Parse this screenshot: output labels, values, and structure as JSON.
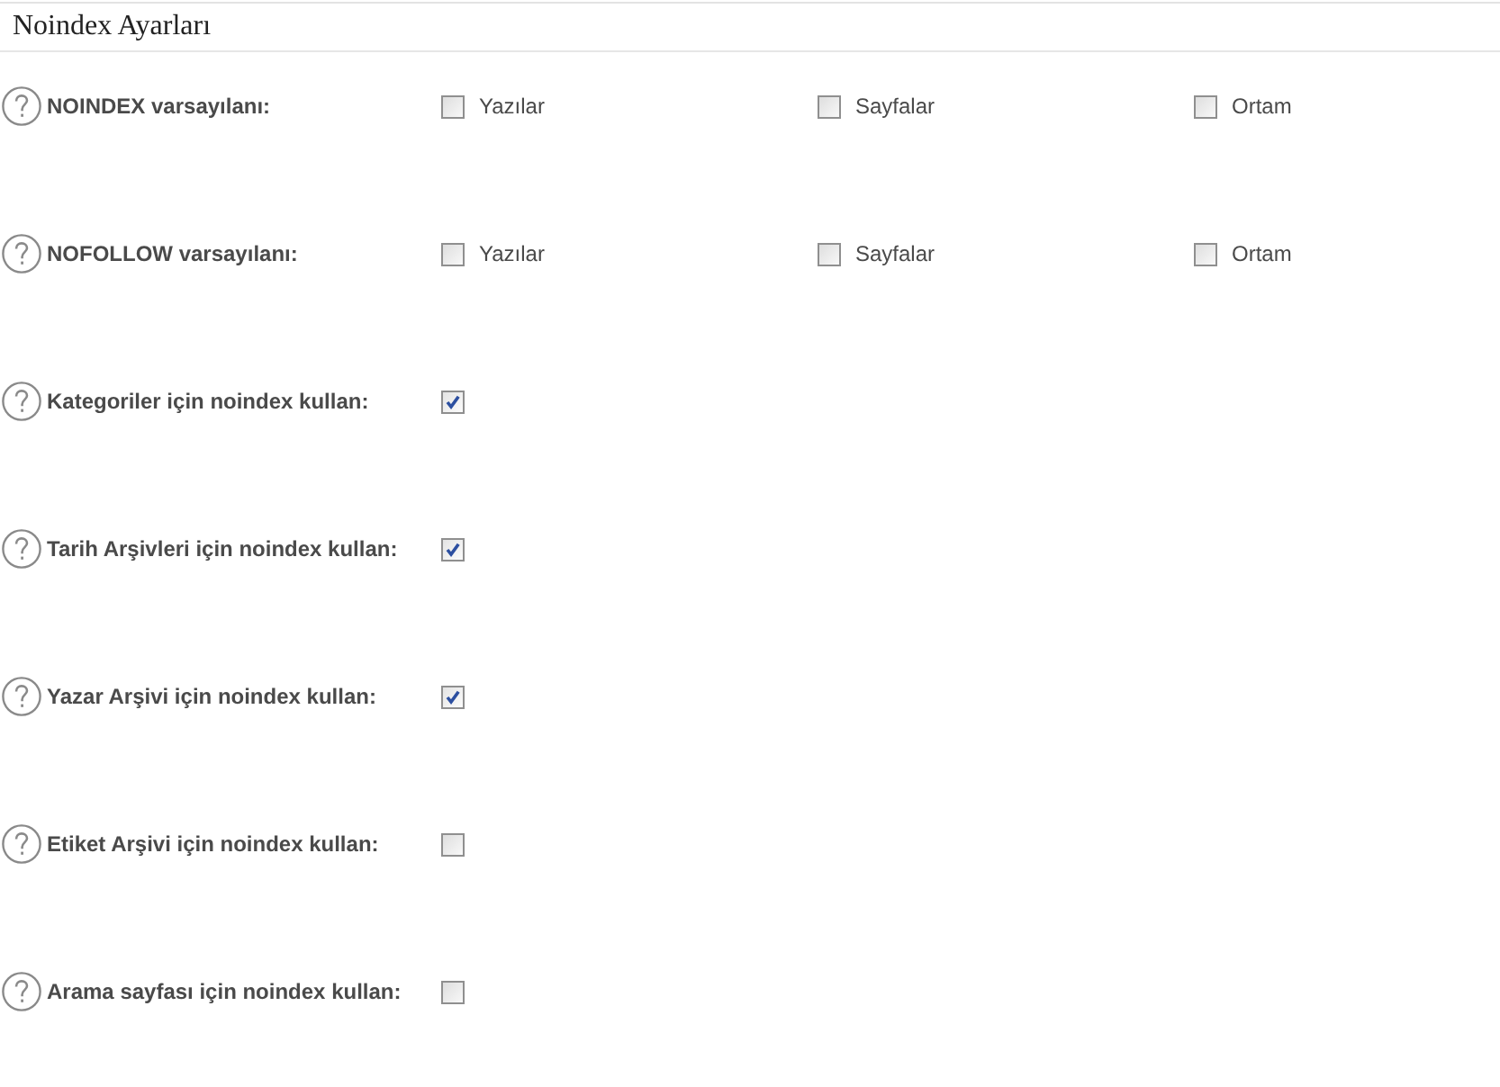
{
  "section": {
    "title": "Noindex Ayarları"
  },
  "settings": [
    {
      "kind": "multi",
      "label": "NOINDEX varsayılanı:",
      "options": [
        {
          "label": "Yazılar",
          "checked": false
        },
        {
          "label": "Sayfalar",
          "checked": false
        },
        {
          "label": "Ortam",
          "checked": false
        }
      ]
    },
    {
      "kind": "multi",
      "label": "NOFOLLOW varsayılanı:",
      "options": [
        {
          "label": "Yazılar",
          "checked": false
        },
        {
          "label": "Sayfalar",
          "checked": false
        },
        {
          "label": "Ortam",
          "checked": false
        }
      ]
    },
    {
      "kind": "single",
      "label": "Kategoriler için noindex kullan:",
      "checked": true
    },
    {
      "kind": "single",
      "label": "Tarih Arşivleri için noindex kullan:",
      "checked": true
    },
    {
      "kind": "single",
      "label": "Yazar Arşivi için noindex kullan:",
      "checked": true
    },
    {
      "kind": "single",
      "label": "Etiket Arşivi için noindex kullan:",
      "checked": false
    },
    {
      "kind": "single",
      "label": "Arama sayfası için noindex kullan:",
      "checked": false
    }
  ]
}
